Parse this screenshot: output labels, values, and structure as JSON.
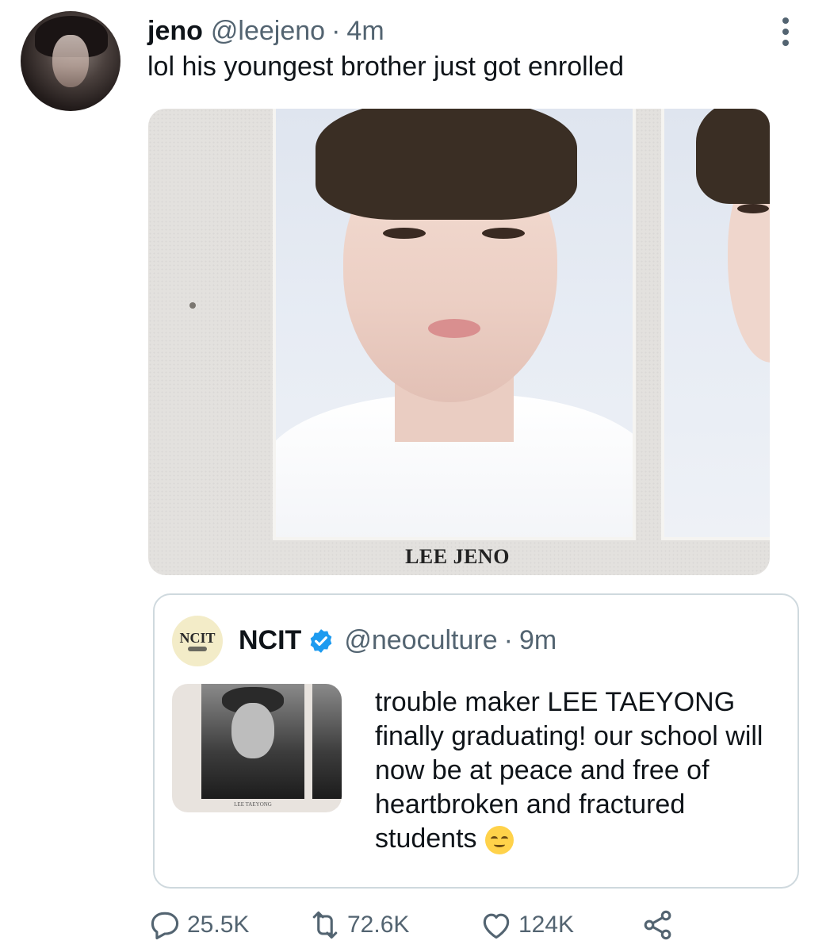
{
  "tweet": {
    "name": "jeno",
    "handle": "@leejeno",
    "separator": "·",
    "time": "4m",
    "text": "lol his youngest brother just got enrolled",
    "media_caption": "LEE JENO"
  },
  "quoted": {
    "avatar_text": "NCIT",
    "name": "NCIT",
    "verified": true,
    "handle": "@neoculture",
    "separator": "·",
    "time": "9m",
    "text": "trouble maker LEE TAEYONG finally graduating! our school will now be at peace and free of heartbroken and fractured students",
    "emoji": "relieved-face",
    "media_caption": "LEE TAEYONG"
  },
  "actions": {
    "replies": "25.5K",
    "retweets": "72.6K",
    "likes": "124K"
  },
  "icons": [
    "more-vertical-icon",
    "verified-badge-icon",
    "reply-icon",
    "retweet-icon",
    "like-icon",
    "share-icon"
  ],
  "colors": {
    "text": "#0f1419",
    "secondary": "#536471",
    "verified": "#1d9bf0",
    "border": "#cfd9de"
  }
}
